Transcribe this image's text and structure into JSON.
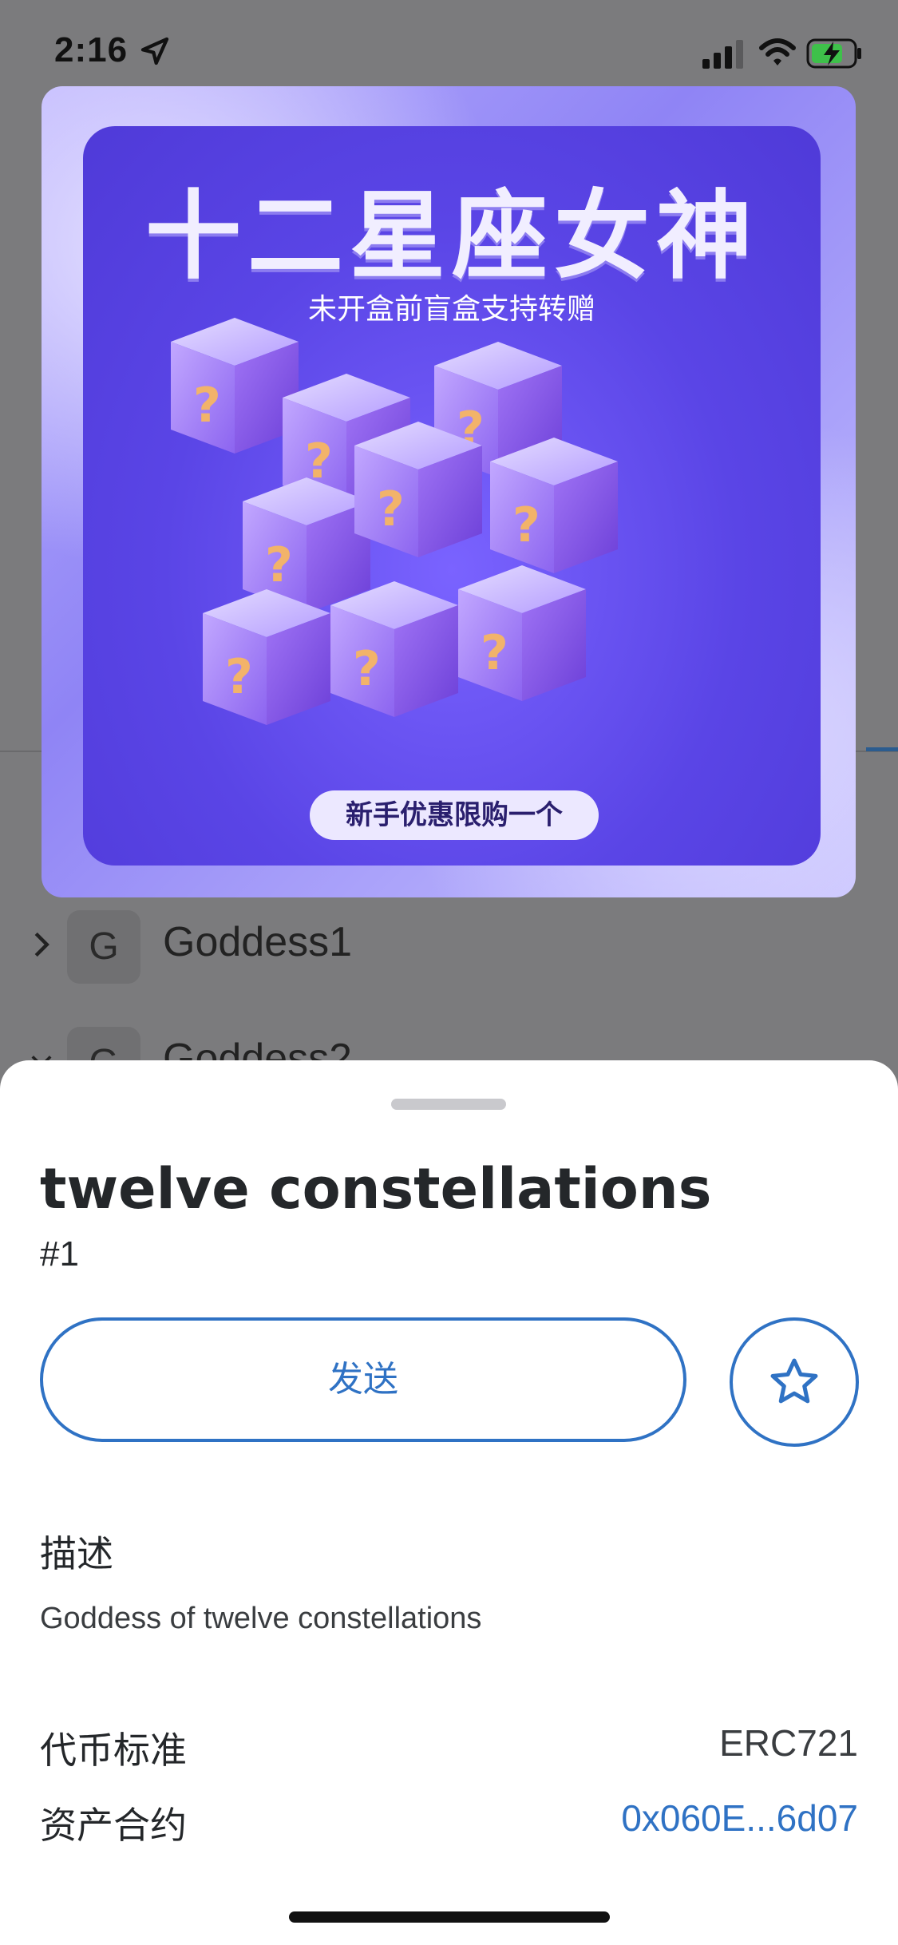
{
  "status_bar": {
    "time": "2:16"
  },
  "background_list": {
    "items": [
      {
        "avatar_letter": "G",
        "name": "Goddess1"
      },
      {
        "avatar_letter": "G",
        "name": "Goddess2"
      }
    ]
  },
  "nft_image": {
    "title": "十二星座女神",
    "subtitle": "未开盒前盲盒支持转赠",
    "badge": "新手优惠限购一个"
  },
  "sheet": {
    "nft_name": "twelve constellations",
    "token_id": "#1",
    "send_label": "发送",
    "description_heading": "描述",
    "description": "Goddess of twelve constellations",
    "details": [
      {
        "label": "代币标准",
        "value": "ERC721",
        "link": false
      },
      {
        "label": "资产合约",
        "value": "0x060E...6d07",
        "link": true
      }
    ]
  },
  "colors": {
    "accent": "#2f72c4",
    "text": "#24272a",
    "overlay": "#7b7b7d"
  }
}
